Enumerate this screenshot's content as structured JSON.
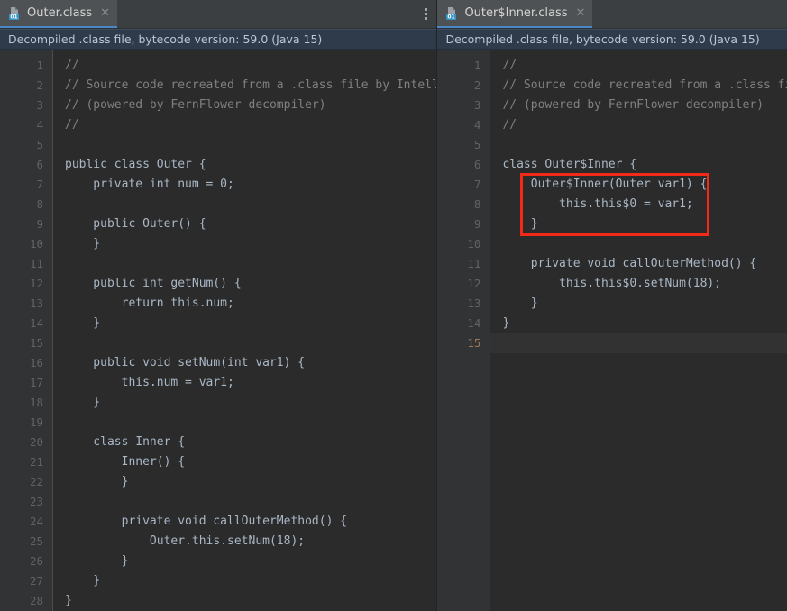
{
  "window": {
    "theme_bg": "#2b2b2b",
    "accent": "#4a88c7",
    "annotation_color": "#f42a18"
  },
  "left_panel": {
    "tab": {
      "label": "Outer.class",
      "icon": "compiled-class-file-icon",
      "close_glyph": "✕"
    },
    "overflow_menu_label": "⋮",
    "banner": {
      "text": "Decompiled .class file, bytecode version: 59.0 (Java 15)"
    },
    "editor": {
      "line_numbers": [
        "1",
        "2",
        "3",
        "4",
        "5",
        "6",
        "7",
        "8",
        "9",
        "10",
        "11",
        "12",
        "13",
        "14",
        "15",
        "16",
        "17",
        "18",
        "19",
        "20",
        "21",
        "22",
        "23",
        "24",
        "25",
        "26",
        "27",
        "28"
      ],
      "lines": [
        {
          "text": "//",
          "kind": "comment"
        },
        {
          "text": "// Source code recreated from a .class file by IntelliJ IDEA",
          "kind": "comment"
        },
        {
          "text": "// (powered by FernFlower decompiler)",
          "kind": "comment"
        },
        {
          "text": "//",
          "kind": "comment"
        },
        {
          "text": "",
          "kind": "code"
        },
        {
          "text": "public class Outer {",
          "kind": "code"
        },
        {
          "text": "    private int num = 0;",
          "kind": "code"
        },
        {
          "text": "",
          "kind": "code"
        },
        {
          "text": "    public Outer() {",
          "kind": "code"
        },
        {
          "text": "    }",
          "kind": "code"
        },
        {
          "text": "",
          "kind": "code"
        },
        {
          "text": "    public int getNum() {",
          "kind": "code"
        },
        {
          "text": "        return this.num;",
          "kind": "code"
        },
        {
          "text": "    }",
          "kind": "code"
        },
        {
          "text": "",
          "kind": "code"
        },
        {
          "text": "    public void setNum(int var1) {",
          "kind": "code"
        },
        {
          "text": "        this.num = var1;",
          "kind": "code"
        },
        {
          "text": "    }",
          "kind": "code"
        },
        {
          "text": "",
          "kind": "code"
        },
        {
          "text": "    class Inner {",
          "kind": "code"
        },
        {
          "text": "        Inner() {",
          "kind": "code"
        },
        {
          "text": "        }",
          "kind": "code"
        },
        {
          "text": "",
          "kind": "code"
        },
        {
          "text": "        private void callOuterMethod() {",
          "kind": "code"
        },
        {
          "text": "            Outer.this.setNum(18);",
          "kind": "code"
        },
        {
          "text": "        }",
          "kind": "code"
        },
        {
          "text": "    }",
          "kind": "code"
        },
        {
          "text": "}",
          "kind": "code"
        }
      ]
    }
  },
  "right_panel": {
    "tab": {
      "label": "Outer$Inner.class",
      "icon": "compiled-class-file-icon",
      "close_glyph": "✕"
    },
    "banner": {
      "text": "Decompiled .class file, bytecode version: 59.0 (Java 15)"
    },
    "editor": {
      "line_numbers": [
        "1",
        "2",
        "3",
        "4",
        "5",
        "6",
        "7",
        "8",
        "9",
        "10",
        "11",
        "12",
        "13",
        "14",
        "15"
      ],
      "caret_line_number": "15",
      "lines": [
        {
          "text": "//",
          "kind": "comment"
        },
        {
          "text": "// Source code recreated from a .class file by IntelliJ IDEA",
          "kind": "comment"
        },
        {
          "text": "// (powered by FernFlower decompiler)",
          "kind": "comment"
        },
        {
          "text": "//",
          "kind": "comment"
        },
        {
          "text": "",
          "kind": "code"
        },
        {
          "text": "class Outer$Inner {",
          "kind": "code"
        },
        {
          "text": "    Outer$Inner(Outer var1) {",
          "kind": "code"
        },
        {
          "text": "        this.this$0 = var1;",
          "kind": "code"
        },
        {
          "text": "    }",
          "kind": "code"
        },
        {
          "text": "",
          "kind": "code"
        },
        {
          "text": "    private void callOuterMethod() {",
          "kind": "code"
        },
        {
          "text": "        this.this$0.setNum(18);",
          "kind": "code"
        },
        {
          "text": "    }",
          "kind": "code"
        },
        {
          "text": "}",
          "kind": "code"
        },
        {
          "text": "",
          "kind": "caret"
        }
      ]
    },
    "annotation": {
      "label": "highlighted-constructor-box",
      "covers_lines": [
        "7",
        "8",
        "9"
      ],
      "color": "#f42a18"
    }
  }
}
